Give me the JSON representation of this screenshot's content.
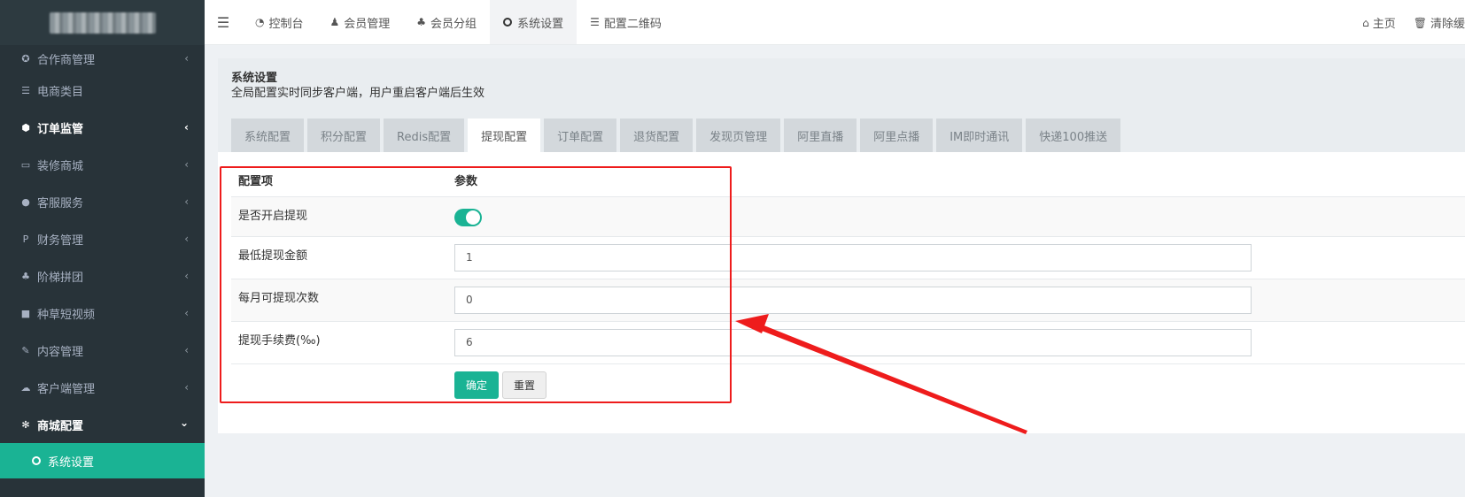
{
  "sidebar": {
    "items": [
      {
        "label": "合作商管理",
        "icon": "handshake-icon"
      },
      {
        "label": "电商类目",
        "icon": "list-icon"
      },
      {
        "label": "订单监管",
        "icon": "cube-icon"
      },
      {
        "label": "装修商城",
        "icon": "desktop-icon"
      },
      {
        "label": "客服服务",
        "icon": "comments-icon"
      },
      {
        "label": "财务管理",
        "icon": "paypal-icon"
      },
      {
        "label": "阶梯拼团",
        "icon": "users-icon"
      },
      {
        "label": "种草短视频",
        "icon": "video-icon"
      },
      {
        "label": "内容管理",
        "icon": "edit-icon"
      },
      {
        "label": "客户端管理",
        "icon": "cloud-icon"
      },
      {
        "label": "商城配置",
        "icon": "gear-icon"
      }
    ],
    "active_sub": "系统设置"
  },
  "topbar": {
    "tabs": [
      {
        "label": "控制台",
        "icon": "dashboard-icon"
      },
      {
        "label": "会员管理",
        "icon": "user-icon"
      },
      {
        "label": "会员分组",
        "icon": "users-icon"
      },
      {
        "label": "系统设置",
        "icon": "circle-icon"
      },
      {
        "label": "配置二维码",
        "icon": "list-icon"
      }
    ],
    "home": "主页",
    "clear": "清除缓"
  },
  "panel": {
    "title": "系统设置",
    "subtitle": "全局配置实时同步客户端，用户重启客户端后生效",
    "tabs": [
      "系统配置",
      "积分配置",
      "Redis配置",
      "提现配置",
      "订单配置",
      "退货配置",
      "发现页管理",
      "阿里直播",
      "阿里点播",
      "IM即时通讯",
      "快递100推送"
    ],
    "active_tab": "提现配置"
  },
  "table": {
    "col_item": "配置项",
    "col_param": "参数",
    "rows": [
      {
        "label": "是否开启提现",
        "value": "",
        "toggle_on": true
      },
      {
        "label": "最低提现金额",
        "value": "1"
      },
      {
        "label": "每月可提现次数",
        "value": "0"
      },
      {
        "label": "提现手续费(‰)",
        "value": "6"
      }
    ],
    "confirm": "确定",
    "reset": "重置"
  },
  "colors": {
    "accent": "#1ab394",
    "sidebar": "#283339",
    "annotation": "#ee1c1c"
  }
}
